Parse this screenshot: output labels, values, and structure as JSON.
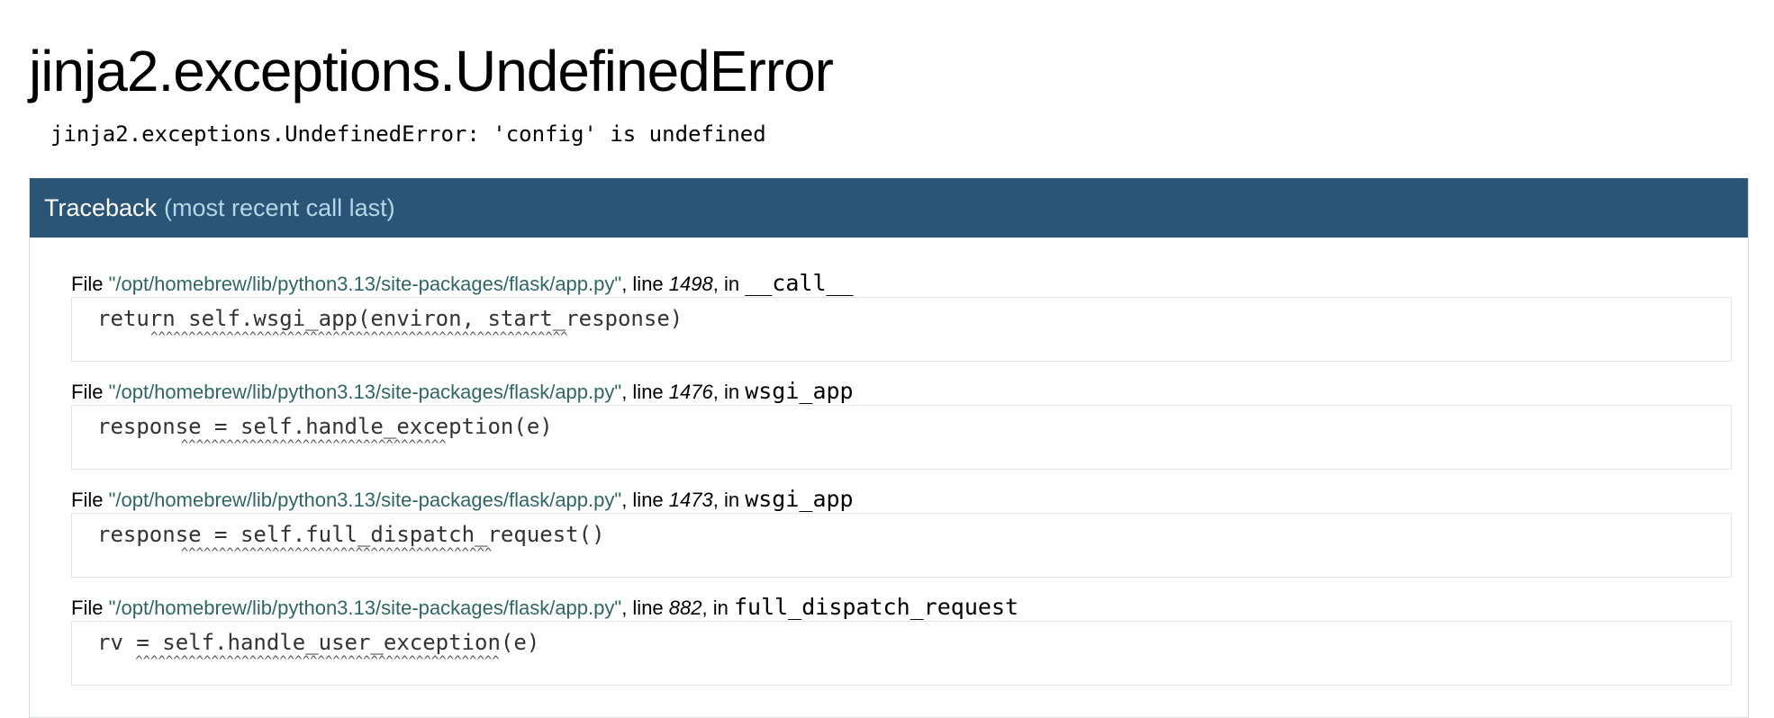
{
  "title": "jinja2.exceptions.UndefinedError",
  "message": "jinja2.exceptions.UndefinedError: 'config' is undefined",
  "traceback": {
    "header": "Traceback",
    "header_sub": "(most recent call last)",
    "file_prefix": "File ",
    "line_prefix": ", line ",
    "in_prefix": ", in ",
    "frames": [
      {
        "filename": "\"/opt/homebrew/lib/python3.13/site-packages/flask/app.py\"",
        "lineno": "1498",
        "funcname": "__call__",
        "code": "return self.wsgi_app(environ, start_response)",
        "caret_indent": "       ",
        "carets": "^^^^^^^^^^^^^^^^^^^^^^^^^^^^^^^^^^^^^^^^^^^^^^^^^^^^^^^"
      },
      {
        "filename": "\"/opt/homebrew/lib/python3.13/site-packages/flask/app.py\"",
        "lineno": "1476",
        "funcname": "wsgi_app",
        "code": "response = self.handle_exception(e)",
        "caret_indent": "           ",
        "carets": "^^^^^^^^^^^^^^^^^^^^^^^^^^^^^^^^^^^"
      },
      {
        "filename": "\"/opt/homebrew/lib/python3.13/site-packages/flask/app.py\"",
        "lineno": "1473",
        "funcname": "wsgi_app",
        "code": "response = self.full_dispatch_request()",
        "caret_indent": "           ",
        "carets": "^^^^^^^^^^^^^^^^^^^^^^^^^^^^^^^^^^^^^^^^^"
      },
      {
        "filename": "\"/opt/homebrew/lib/python3.13/site-packages/flask/app.py\"",
        "lineno": "882",
        "funcname": "full_dispatch_request",
        "code": "rv = self.handle_user_exception(e)",
        "caret_indent": "     ",
        "carets": "^^^^^^^^^^^^^^^^^^^^^^^^^^^^^^^^^^^^^^^^^^^^^^^^"
      }
    ]
  }
}
